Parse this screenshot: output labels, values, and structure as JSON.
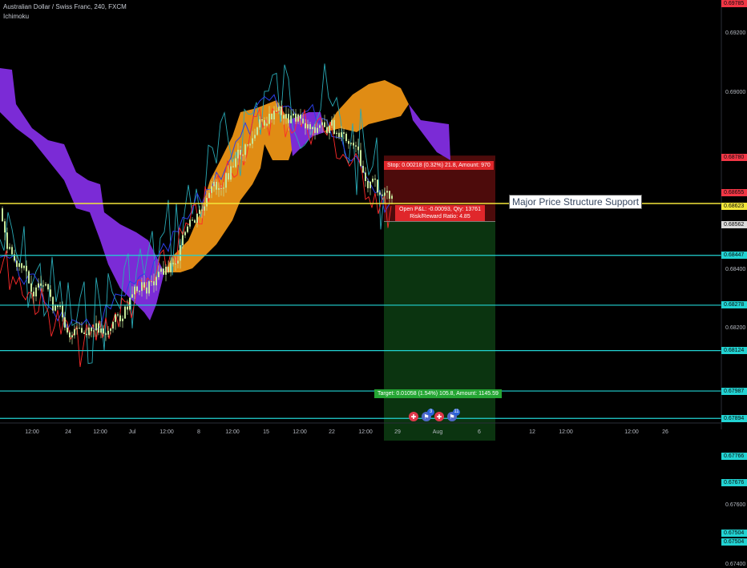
{
  "header": {
    "title": "Australian Dollar / Swiss Franc, 240, FXCM",
    "indicator": "Ichimoku"
  },
  "annotation": "Major Price Structure Support",
  "position": {
    "stop_text": "Stop: 0.00218 (0.32%) 21.8, Amount: 970",
    "pnl_text": "Open P&L: -0.00093, Qty: 13761",
    "rr_text": "Risk/Reward Ratio: 4.85",
    "target_text": "Target: 0.01058 (1.54%) 105.8, Amount: 1145.59"
  },
  "price_scale": {
    "ticks": [
      "0.69600",
      "0.69400",
      "0.69200",
      "0.69000",
      "0.68400",
      "0.68200",
      "0.67600",
      "0.67400"
    ],
    "labels": [
      {
        "text": "0.69785",
        "color": "#f23645"
      },
      {
        "text": "0.68780",
        "color": "#f23645"
      },
      {
        "text": "0.68655",
        "color": "#f23645"
      },
      {
        "text": "0.68623",
        "color": "#f2e63a"
      },
      {
        "text": "0.68562",
        "color": "#d9d9d9"
      },
      {
        "text": "0.68447",
        "color": "#22d3d3"
      },
      {
        "text": "0.68278",
        "color": "#22d3d3"
      },
      {
        "text": "0.68124",
        "color": "#22d3d3"
      },
      {
        "text": "0.67987",
        "color": "#22d3d3"
      },
      {
        "text": "0.67894",
        "color": "#22d3d3"
      },
      {
        "text": "0.67766",
        "color": "#22d3d3"
      },
      {
        "text": "0.67676",
        "color": "#22d3d3"
      },
      {
        "text": "0.67504",
        "color": "#22d3d3"
      },
      {
        "text": "0.67504",
        "color": "#22d3d3"
      }
    ]
  },
  "time_axis": [
    "12:00",
    "24",
    "12:00",
    "Jul",
    "12:00",
    "8",
    "12:00",
    "15",
    "12:00",
    "22",
    "12:00",
    "29",
    "Aug",
    "6",
    "12",
    "12:00",
    "12:00",
    "26"
  ],
  "events": [
    {
      "name": "event-flag-1",
      "symbol": "✚",
      "color": "#e0384b",
      "badge": ""
    },
    {
      "name": "event-flag-2",
      "symbol": "⚑",
      "color": "#4f68c8",
      "badge": "3"
    },
    {
      "name": "event-flag-3",
      "symbol": "✚",
      "color": "#e0384b",
      "badge": ""
    },
    {
      "name": "event-flag-4",
      "symbol": "⚑",
      "color": "#4f68c8",
      "badge": "11"
    }
  ],
  "colors": {
    "background": "#000000",
    "kumo_bearish": "#7b2bd6",
    "kumo_bullish": "#e08c14",
    "candle": "#c6e69a",
    "tenkan": "#ff2a2a",
    "kijun": "#2b3fe6",
    "chikou": "#29a9b5",
    "support_line": "#f2e63a",
    "level_line": "#22d3d3",
    "stop_zone": "#5a0d0d",
    "target_zone": "#0c3a12",
    "stop_label": "#e0272b",
    "target_label": "#25a634"
  }
}
